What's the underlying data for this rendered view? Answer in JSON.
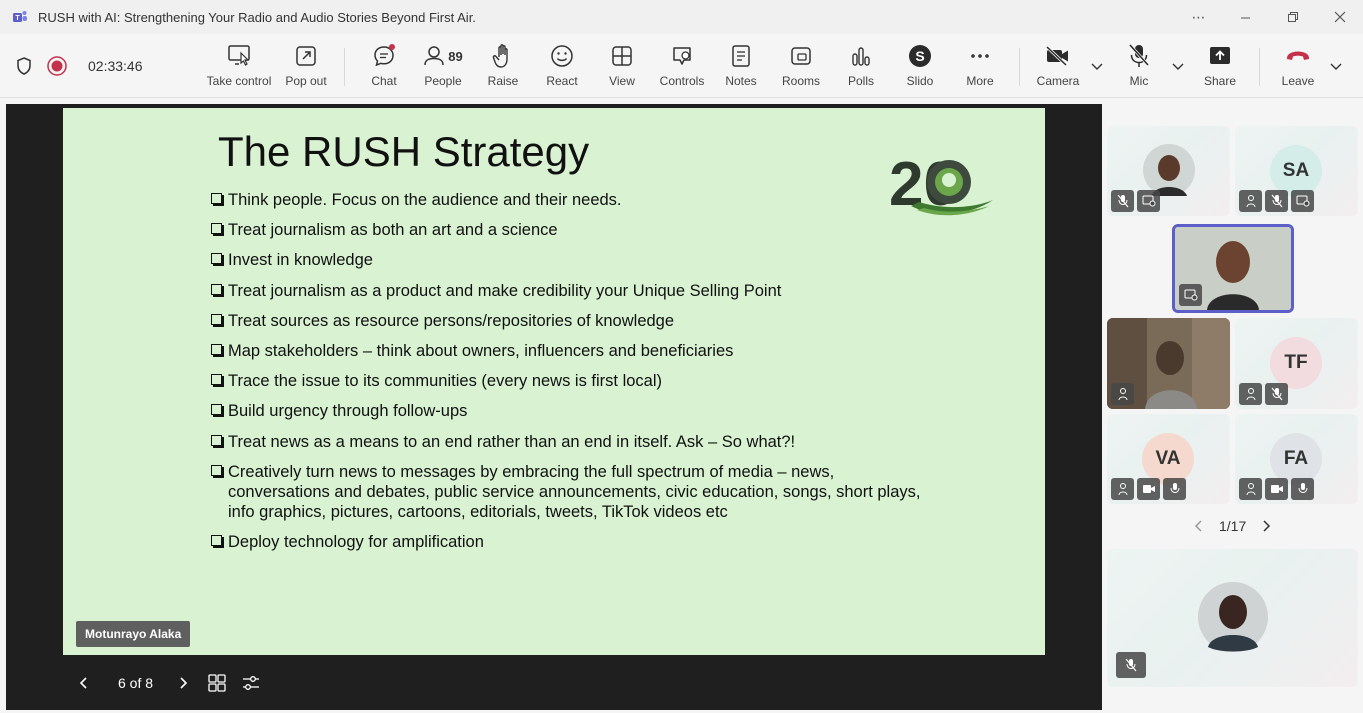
{
  "window": {
    "title": "RUSH with AI: Strengthening Your Radio and Audio Stories Beyond First Air."
  },
  "toolbar": {
    "timer": "02:33:46",
    "people_count": "89",
    "buttons": {
      "take_control": "Take control",
      "pop_out": "Pop out",
      "chat": "Chat",
      "people": "People",
      "raise": "Raise",
      "react": "React",
      "view": "View",
      "controls": "Controls",
      "notes": "Notes",
      "rooms": "Rooms",
      "polls": "Polls",
      "slido": "Slido",
      "more": "More",
      "camera": "Camera",
      "mic": "Mic",
      "share": "Share",
      "leave": "Leave"
    }
  },
  "slide": {
    "title": "The RUSH Strategy",
    "bullets": [
      "Think people. Focus on the audience and their needs.",
      "Treat journalism as both an art and a science",
      "Invest in knowledge",
      "Treat journalism as a product and make credibility your Unique Selling Point",
      "Treat sources as resource persons/repositories of knowledge",
      "Map stakeholders – think about owners, influencers and beneficiaries",
      "Trace the issue to its communities (every news is first local)",
      "Build urgency through follow-ups",
      "Treat news as a means to an end rather than an end in itself. Ask – So what?!",
      "Creatively turn news to messages by embracing the full spectrum of media – news, conversations and debates, public service announcements, civic education, songs, short plays, info graphics, pictures, cartoons, editorials, tweets, TikTok videos etc",
      "Deploy technology for amplification"
    ],
    "logo_text": "20",
    "presenter_name": "Motunrayo Alaka",
    "position": "6 of 8"
  },
  "participants": {
    "tiles": [
      {
        "initials": ""
      },
      {
        "initials": "SA"
      },
      {
        "initials": ""
      },
      {
        "initials": ""
      },
      {
        "initials": "TF"
      },
      {
        "initials": "VA"
      },
      {
        "initials": "FA"
      },
      {
        "initials": ""
      }
    ],
    "pager": "1/17"
  },
  "colors": {
    "slide_bg": "#d8f2d2",
    "active_speaker_border": "#5b5fc7",
    "record": "#c4314b",
    "leave": "#c4314b"
  }
}
